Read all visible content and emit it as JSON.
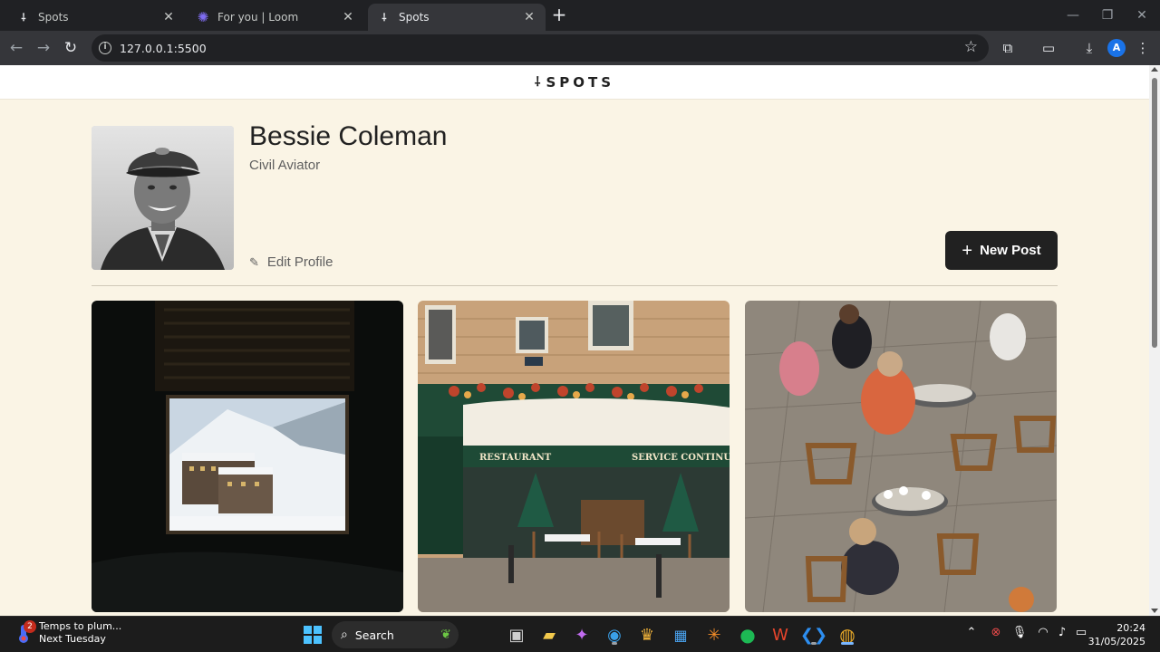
{
  "browser": {
    "tabs": [
      {
        "title": "Spots",
        "icon": "spots-favicon",
        "active": false
      },
      {
        "title": "For you | Loom",
        "icon": "loom-favicon",
        "active": false
      },
      {
        "title": "Spots",
        "icon": "spots-favicon",
        "active": true
      }
    ],
    "url": "127.0.0.1:5500",
    "profile_initial": "A"
  },
  "site": {
    "logo_text": "SPOTS",
    "logo_mark": "⸸"
  },
  "profile": {
    "name": "Bessie Coleman",
    "description": "Civil Aviator",
    "edit_label": "Edit Profile",
    "new_post_label": "New Post"
  },
  "cards": [
    {
      "image": "snowy-village-through-window"
    },
    {
      "image": "paris-restaurant-facade"
    },
    {
      "image": "outdoor-cafe-terrace"
    }
  ],
  "taskbar": {
    "weather_title": "Temps to plum...",
    "weather_sub": "Next Tuesday",
    "notification_count": "2",
    "search_label": "Search",
    "time": "20:24",
    "date": "31/05/2025"
  },
  "colors": {
    "page_bg": "#faf4e5",
    "button_bg": "#212121",
    "text_primary": "#212121",
    "text_secondary": "#5f5f5f"
  }
}
